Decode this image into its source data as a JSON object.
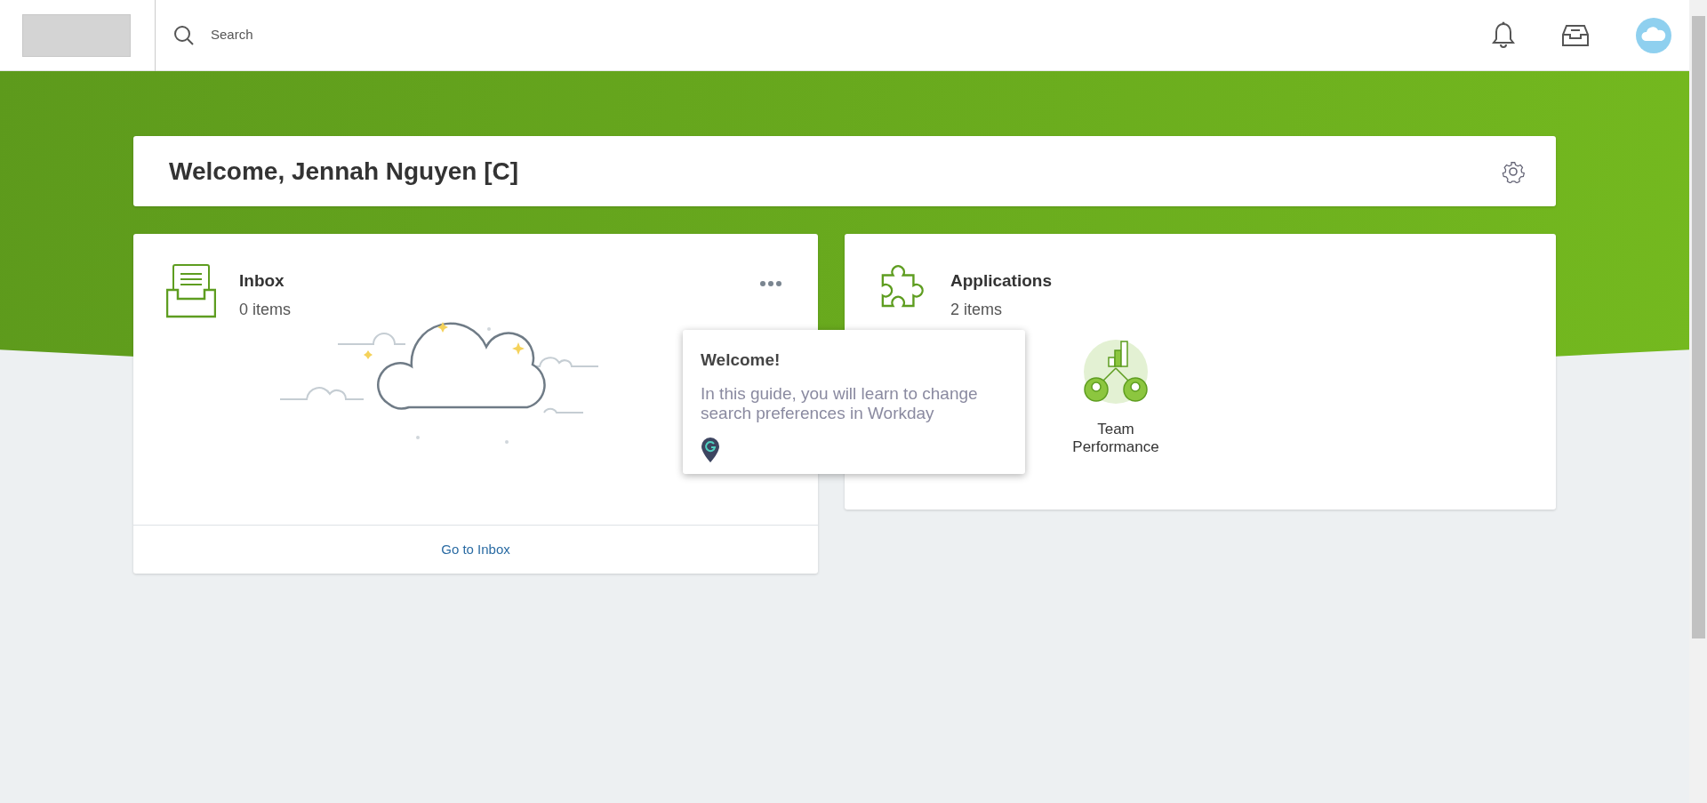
{
  "header": {
    "search": {
      "placeholder": "Search"
    }
  },
  "welcome": {
    "title": "Welcome, Jennah Nguyen [C]"
  },
  "inbox": {
    "title": "Inbox",
    "count": "0 items",
    "footer_link": "Go to Inbox"
  },
  "applications": {
    "title": "Applications",
    "count": "2 items",
    "apps": [
      {
        "label": "Team Performance"
      }
    ]
  },
  "guide_popup": {
    "title": "Welcome!",
    "body": "In this guide, you will learn to change search preferences in Workday"
  }
}
